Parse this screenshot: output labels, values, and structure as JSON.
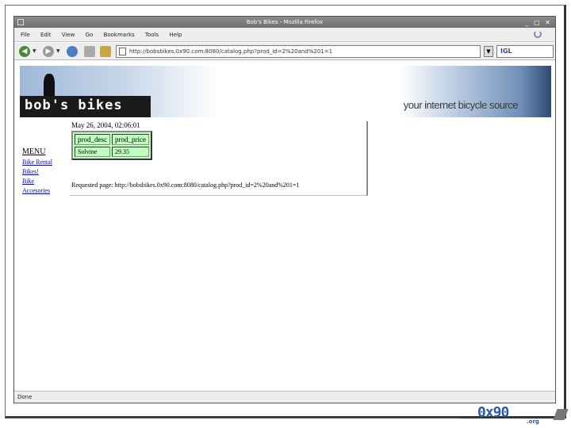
{
  "window": {
    "title": "Bob's Bikes - Mozilla Firefox",
    "controls": "_ □ ✕"
  },
  "menubar": {
    "items": [
      "File",
      "Edit",
      "View",
      "Go",
      "Bookmarks",
      "Tools",
      "Help"
    ]
  },
  "navbar": {
    "url": "http://bobsbikes.0x90.com:8080/catalog.php?prod_id=2%20and%201=1",
    "search_text": "IGL",
    "back_glyph": "◀",
    "forward_glyph": "▶",
    "dropdown_glyph": "▼"
  },
  "banner": {
    "logo_text": "bob's bikes",
    "tagline": "your internet bicycle source"
  },
  "sidebar": {
    "title": "MENU",
    "links": [
      "Bike Rental",
      "Bikes!",
      "Bike",
      "Accesories"
    ]
  },
  "main": {
    "date": "May 26, 2004, 02:06:01",
    "table": {
      "headers": [
        "prod_desc",
        "prod_price"
      ],
      "rows": [
        [
          "Solvine",
          "29.35"
        ]
      ]
    },
    "requested": "Requested page: http://bobsbikes.0x90.com:8080/catalog.php?prod_id=2%20and%201=1"
  },
  "statusbar": {
    "text": "Done"
  },
  "footer": {
    "logo_main": "0x90",
    "logo_sub": ".org"
  },
  "colors": {
    "table_bg": "#bfffbf",
    "link": "#0000cc",
    "logo_blue": "#2a5aa8"
  }
}
